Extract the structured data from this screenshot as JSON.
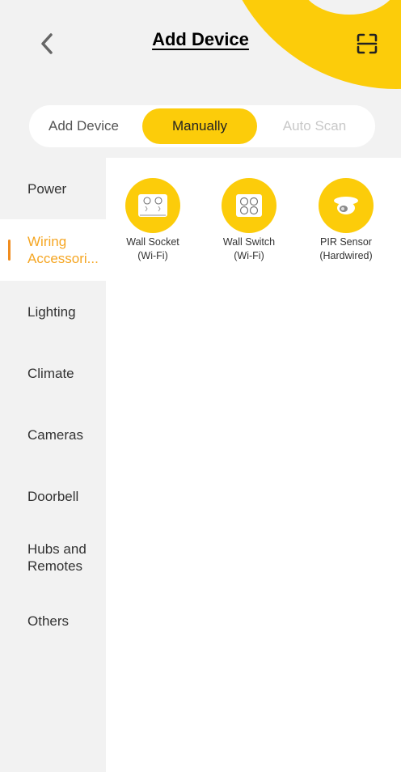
{
  "header": {
    "title": "Add Device",
    "back_icon": "chevron-left-icon",
    "scan_icon": "scan-icon"
  },
  "segment": {
    "label": "Add Device",
    "manual": "Manually",
    "auto": "Auto Scan"
  },
  "sidebar": {
    "items": [
      {
        "label": "Power"
      },
      {
        "label": "Wiring\nAccessori..."
      },
      {
        "label": "Lighting"
      },
      {
        "label": "Climate"
      },
      {
        "label": "Cameras"
      },
      {
        "label": "Doorbell"
      },
      {
        "label": "Hubs and\nRemotes"
      },
      {
        "label": "Others"
      }
    ],
    "active_index": 1
  },
  "devices": [
    {
      "name": "Wall Socket",
      "sub": "(Wi-Fi)",
      "icon": "wall-socket-icon"
    },
    {
      "name": "Wall Switch",
      "sub": "(Wi-Fi)",
      "icon": "wall-switch-icon"
    },
    {
      "name": "PIR Sensor",
      "sub": "(Hardwired)",
      "icon": "pir-sensor-icon"
    }
  ],
  "colors": {
    "accent": "#fccc0a",
    "active_text": "#f5a623",
    "background": "#f2f2f2"
  }
}
